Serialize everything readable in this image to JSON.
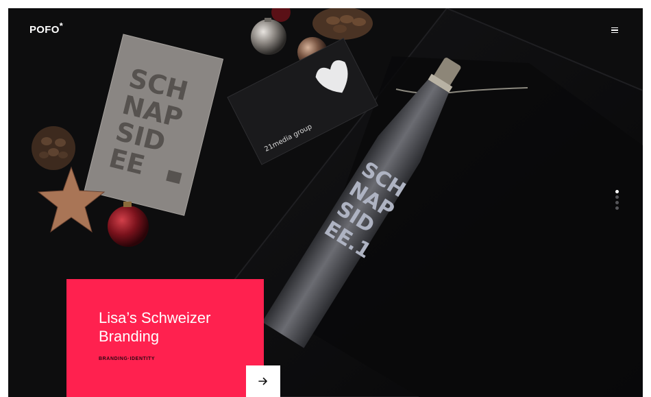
{
  "header": {
    "logo_text": "POFO",
    "logo_mark": "*",
    "menu_icon": "hamburger-icon"
  },
  "hero": {
    "card_text": [
      "SCH",
      "NAP",
      "SID",
      "EE"
    ],
    "card_small": "ᴰᶠ",
    "tag_brand": "21media group",
    "bottle_text": [
      "SCH",
      "NAP",
      "SID",
      "EE.1"
    ]
  },
  "slider": {
    "dot_count": 4,
    "active_index": 0
  },
  "caption": {
    "title": "Lisa’s Schweizer Branding",
    "category_1": "Branding",
    "category_2": "Identity",
    "category_sep": "·",
    "arrow_icon": "arrow-right-icon"
  },
  "colors": {
    "accent": "#ff214f",
    "background": "#0c0c0d"
  }
}
